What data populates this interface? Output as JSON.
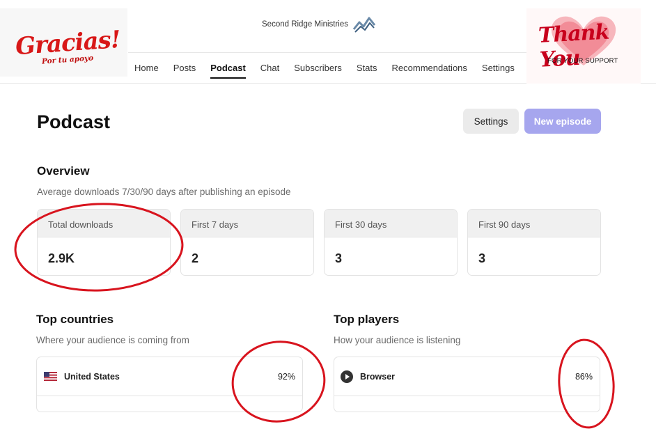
{
  "header": {
    "brand_name": "Second Ridge Ministries",
    "nav": [
      {
        "label": "Home"
      },
      {
        "label": "Posts"
      },
      {
        "label": "Podcast",
        "active": true
      },
      {
        "label": "Chat"
      },
      {
        "label": "Subscribers"
      },
      {
        "label": "Stats"
      },
      {
        "label": "Recommendations"
      },
      {
        "label": "Settings"
      }
    ]
  },
  "stickers": {
    "left": {
      "title": "Gracias!",
      "subtitle": "Por tu apoyo"
    },
    "right": {
      "title": "Thank You",
      "subtitle": "FOR YOUR SUPPORT"
    }
  },
  "page": {
    "title": "Podcast",
    "settings_button": "Settings",
    "new_episode_button": "New episode"
  },
  "overview": {
    "title": "Overview",
    "subtitle": "Average downloads 7/30/90 days after publishing an episode",
    "stats": [
      {
        "label": "Total downloads",
        "value": "2.9K"
      },
      {
        "label": "First 7 days",
        "value": "2"
      },
      {
        "label": "First 30 days",
        "value": "3"
      },
      {
        "label": "First 90 days",
        "value": "3"
      }
    ]
  },
  "top_countries": {
    "title": "Top countries",
    "subtitle": "Where your audience is coming from",
    "rows": [
      {
        "label": "United States",
        "percent": "92%",
        "icon": "us-flag-icon"
      }
    ]
  },
  "top_players": {
    "title": "Top players",
    "subtitle": "How your audience is listening",
    "rows": [
      {
        "label": "Browser",
        "percent": "86%",
        "icon": "play-icon"
      }
    ]
  },
  "colors": {
    "accent": "#a6a6ee",
    "annotation_red": "#d8141e",
    "card_header_bg": "#f0f0f0"
  }
}
